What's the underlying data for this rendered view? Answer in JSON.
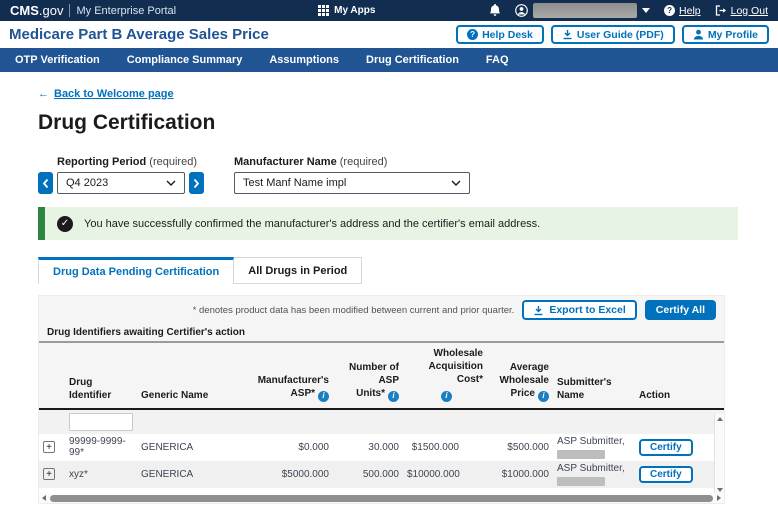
{
  "topbar": {
    "brand_cms": "CMS",
    "brand_gov": ".gov",
    "portal_name": "My Enterprise Portal",
    "my_apps": "My Apps",
    "help": "Help",
    "log_out": "Log Out"
  },
  "header": {
    "app_title": "Medicare Part B Average Sales Price",
    "help_desk": "Help Desk",
    "user_guide": "User Guide (PDF)",
    "my_profile": "My Profile"
  },
  "nav": {
    "items": [
      "OTP Verification",
      "Compliance Summary",
      "Assumptions",
      "Drug Certification",
      "FAQ"
    ]
  },
  "page": {
    "back_link": "Back to Welcome page",
    "title": "Drug Certification"
  },
  "form": {
    "reporting_period_label": "Reporting Period",
    "reporting_period_required": "(required)",
    "reporting_period_value": "Q4 2023",
    "manufacturer_label": "Manufacturer Name",
    "manufacturer_required": "(required)",
    "manufacturer_value": "Test Manf Name impl"
  },
  "alert": {
    "message": "You have successfully confirmed the manufacturer's address and the certifier's email address."
  },
  "tabs": {
    "pending": "Drug Data Pending Certification",
    "all_drugs": "All Drugs in Period"
  },
  "table": {
    "note": "* denotes product data has been modified between current and prior quarter.",
    "export_label": "Export to Excel",
    "certify_all_label": "Certify All",
    "section_title": "Drug Identifiers awaiting Certifier's action",
    "columns": {
      "drug_identifier": "Drug Identifier",
      "generic_name": "Generic Name",
      "manu_asp_l1": "Manufacturer's",
      "manu_asp_l2": "ASP*",
      "units_l1": "Number of ASP",
      "units_l2": "Units*",
      "wac_l1": "Wholesale",
      "wac_l2": "Acquisition Cost*",
      "awp_l1": "Average Wholesale",
      "awp_l2": "Price",
      "submitter": "Submitter's Name",
      "action": "Action"
    },
    "rows": [
      {
        "id": "99999-9999-99*",
        "generic": "GENERICA",
        "asp": "$0.000",
        "units": "30.000",
        "wac": "$1500.000",
        "awp": "$500.000",
        "submitter": "ASP Submitter,",
        "action": "Certify"
      },
      {
        "id": "xyz*",
        "generic": "GENERICA",
        "asp": "$5000.000",
        "units": "500.000",
        "wac": "$10000.000",
        "awp": "$1000.000",
        "submitter": "ASP Submitter,",
        "action": "Certify"
      }
    ]
  },
  "icons": {
    "info": "i",
    "expand": "+",
    "check": "✓",
    "back_arrow": "←",
    "question": "?"
  },
  "colors": {
    "topbar_navy": "#112e51",
    "nav_blue": "#205493",
    "accent_blue": "#0071bc",
    "success_green": "#2e8540",
    "success_bg": "#e7f4e4"
  }
}
